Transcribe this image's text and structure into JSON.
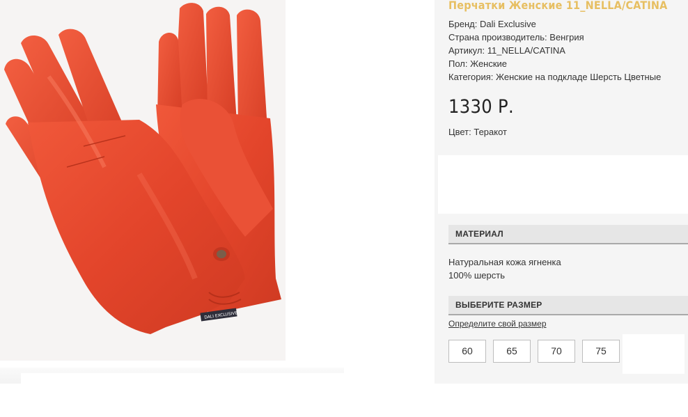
{
  "product": {
    "title": "Перчатки Женские 11_NELLA/CATINA",
    "attributes": [
      {
        "text": "Бренд: Dali Exclusive"
      },
      {
        "text": "Страна производитель: Венгрия"
      },
      {
        "text": "Артикул: 11_NELLA/CATINA"
      },
      {
        "text": "Пол: Женские"
      },
      {
        "text": "Категория: Женские на подкладе Шерсть Цветные"
      }
    ],
    "price": "1330 Р.",
    "color_line": "Цвет: Теракот",
    "image_label": "DALI EXCLUSIVE"
  },
  "material": {
    "heading": "МАТЕРИАЛ",
    "lines": [
      "Натуральная кожа ягненка",
      "100% шерсть"
    ]
  },
  "size": {
    "heading": "ВЫБЕРИТЕ РАЗМЕР",
    "guide_link": "Определите свой размер",
    "options": [
      "60",
      "65",
      "70",
      "75"
    ]
  },
  "colors": {
    "title_accent": "#e7bf62",
    "glove": "#e8492f",
    "panel_bg": "#f5f5f5",
    "section_head_bg": "#e6e6e6"
  }
}
